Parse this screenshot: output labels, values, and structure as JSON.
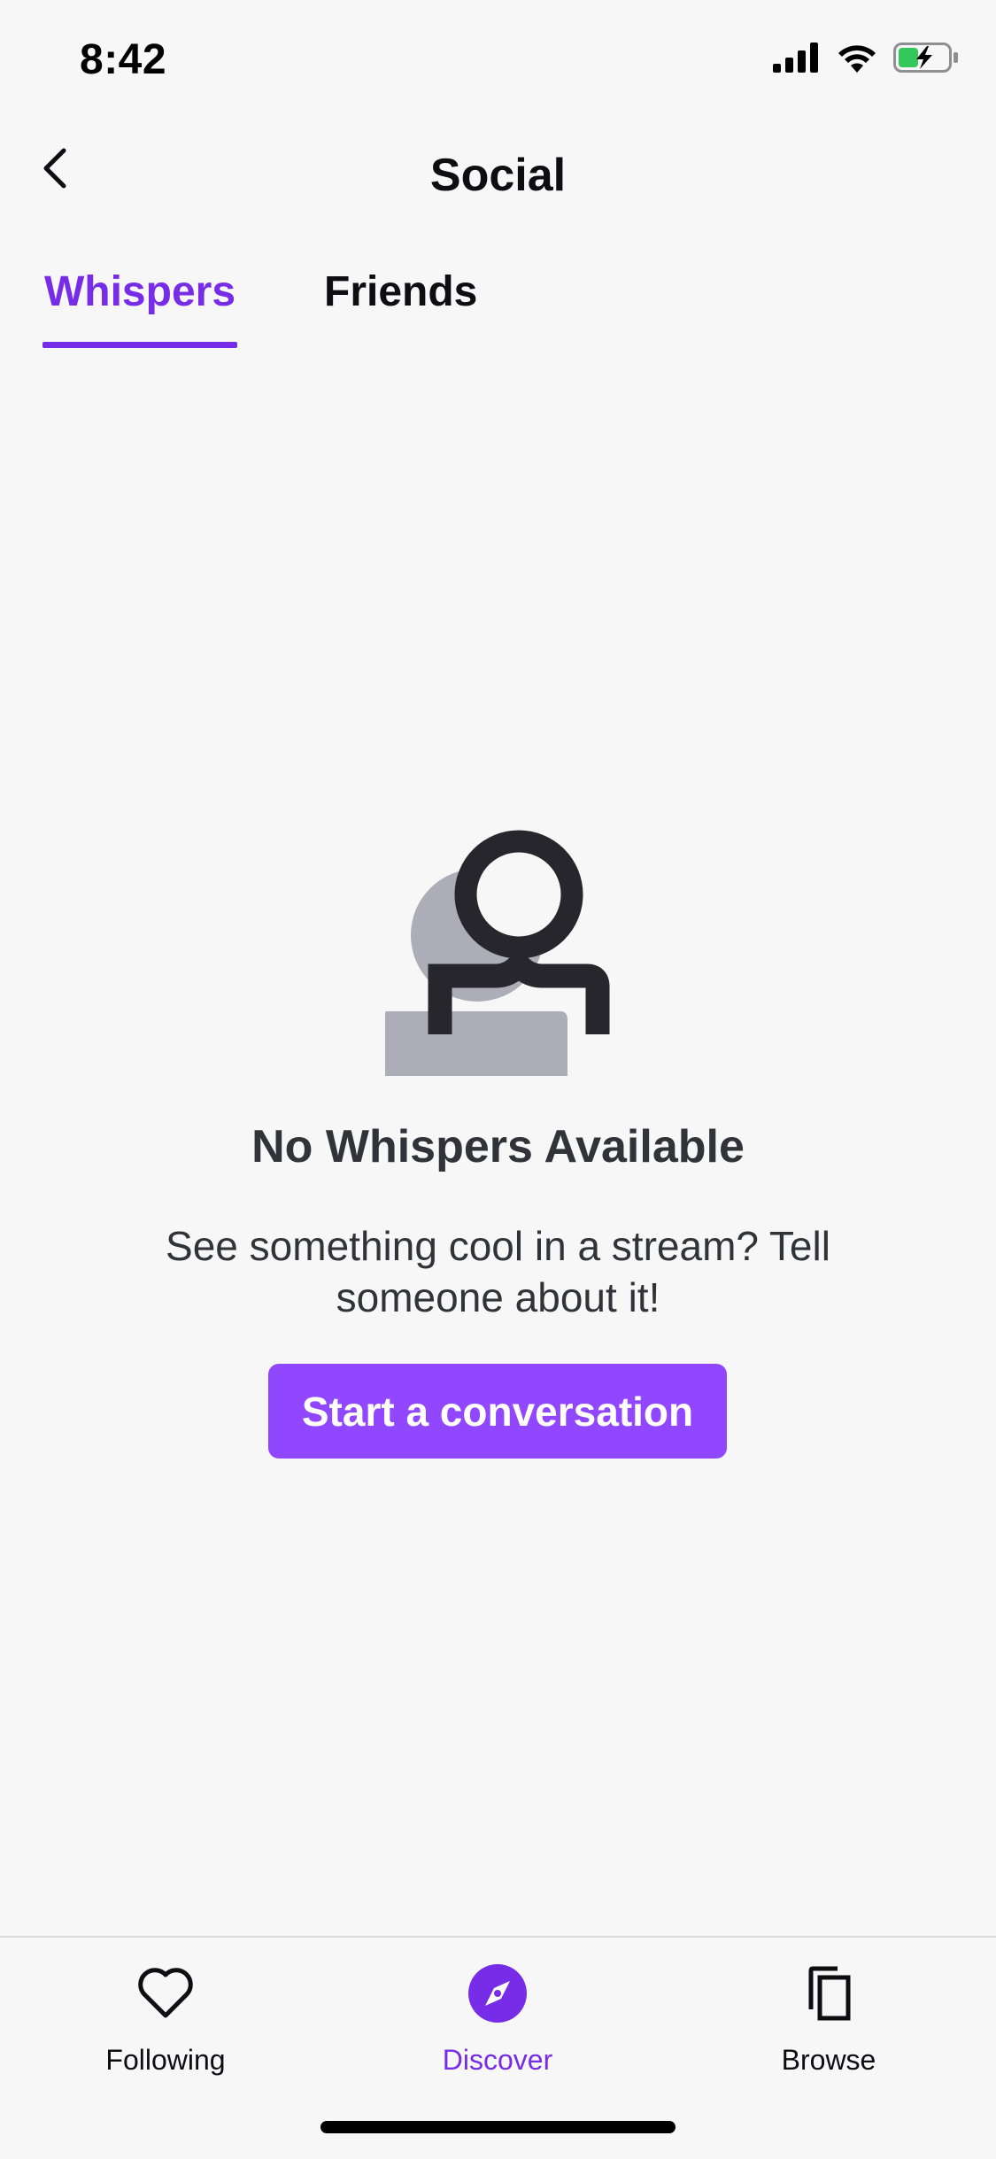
{
  "status_bar": {
    "time": "8:42",
    "icons": [
      "cellular-signal-icon",
      "wifi-icon",
      "battery-charging-icon"
    ]
  },
  "header": {
    "title": "Social",
    "back_icon": "chevron-left-icon"
  },
  "tabs": [
    {
      "label": "Whispers",
      "active": true
    },
    {
      "label": "Friends",
      "active": false
    }
  ],
  "empty_state": {
    "illustration": "users-icon",
    "title": "No Whispers Available",
    "description": "See something cool in a stream? Tell someone about it!",
    "button_label": "Start a conversation"
  },
  "bottom_nav": {
    "items": [
      {
        "label": "Following",
        "icon": "heart-icon",
        "active": false
      },
      {
        "label": "Discover",
        "icon": "compass-icon",
        "active": true
      },
      {
        "label": "Browse",
        "icon": "copy-icon",
        "active": false
      }
    ]
  },
  "colors": {
    "accent": "#772ce8",
    "button": "#9147ff",
    "background": "#f7f7f8",
    "text": "#0e0e10",
    "muted_text": "#323239"
  }
}
